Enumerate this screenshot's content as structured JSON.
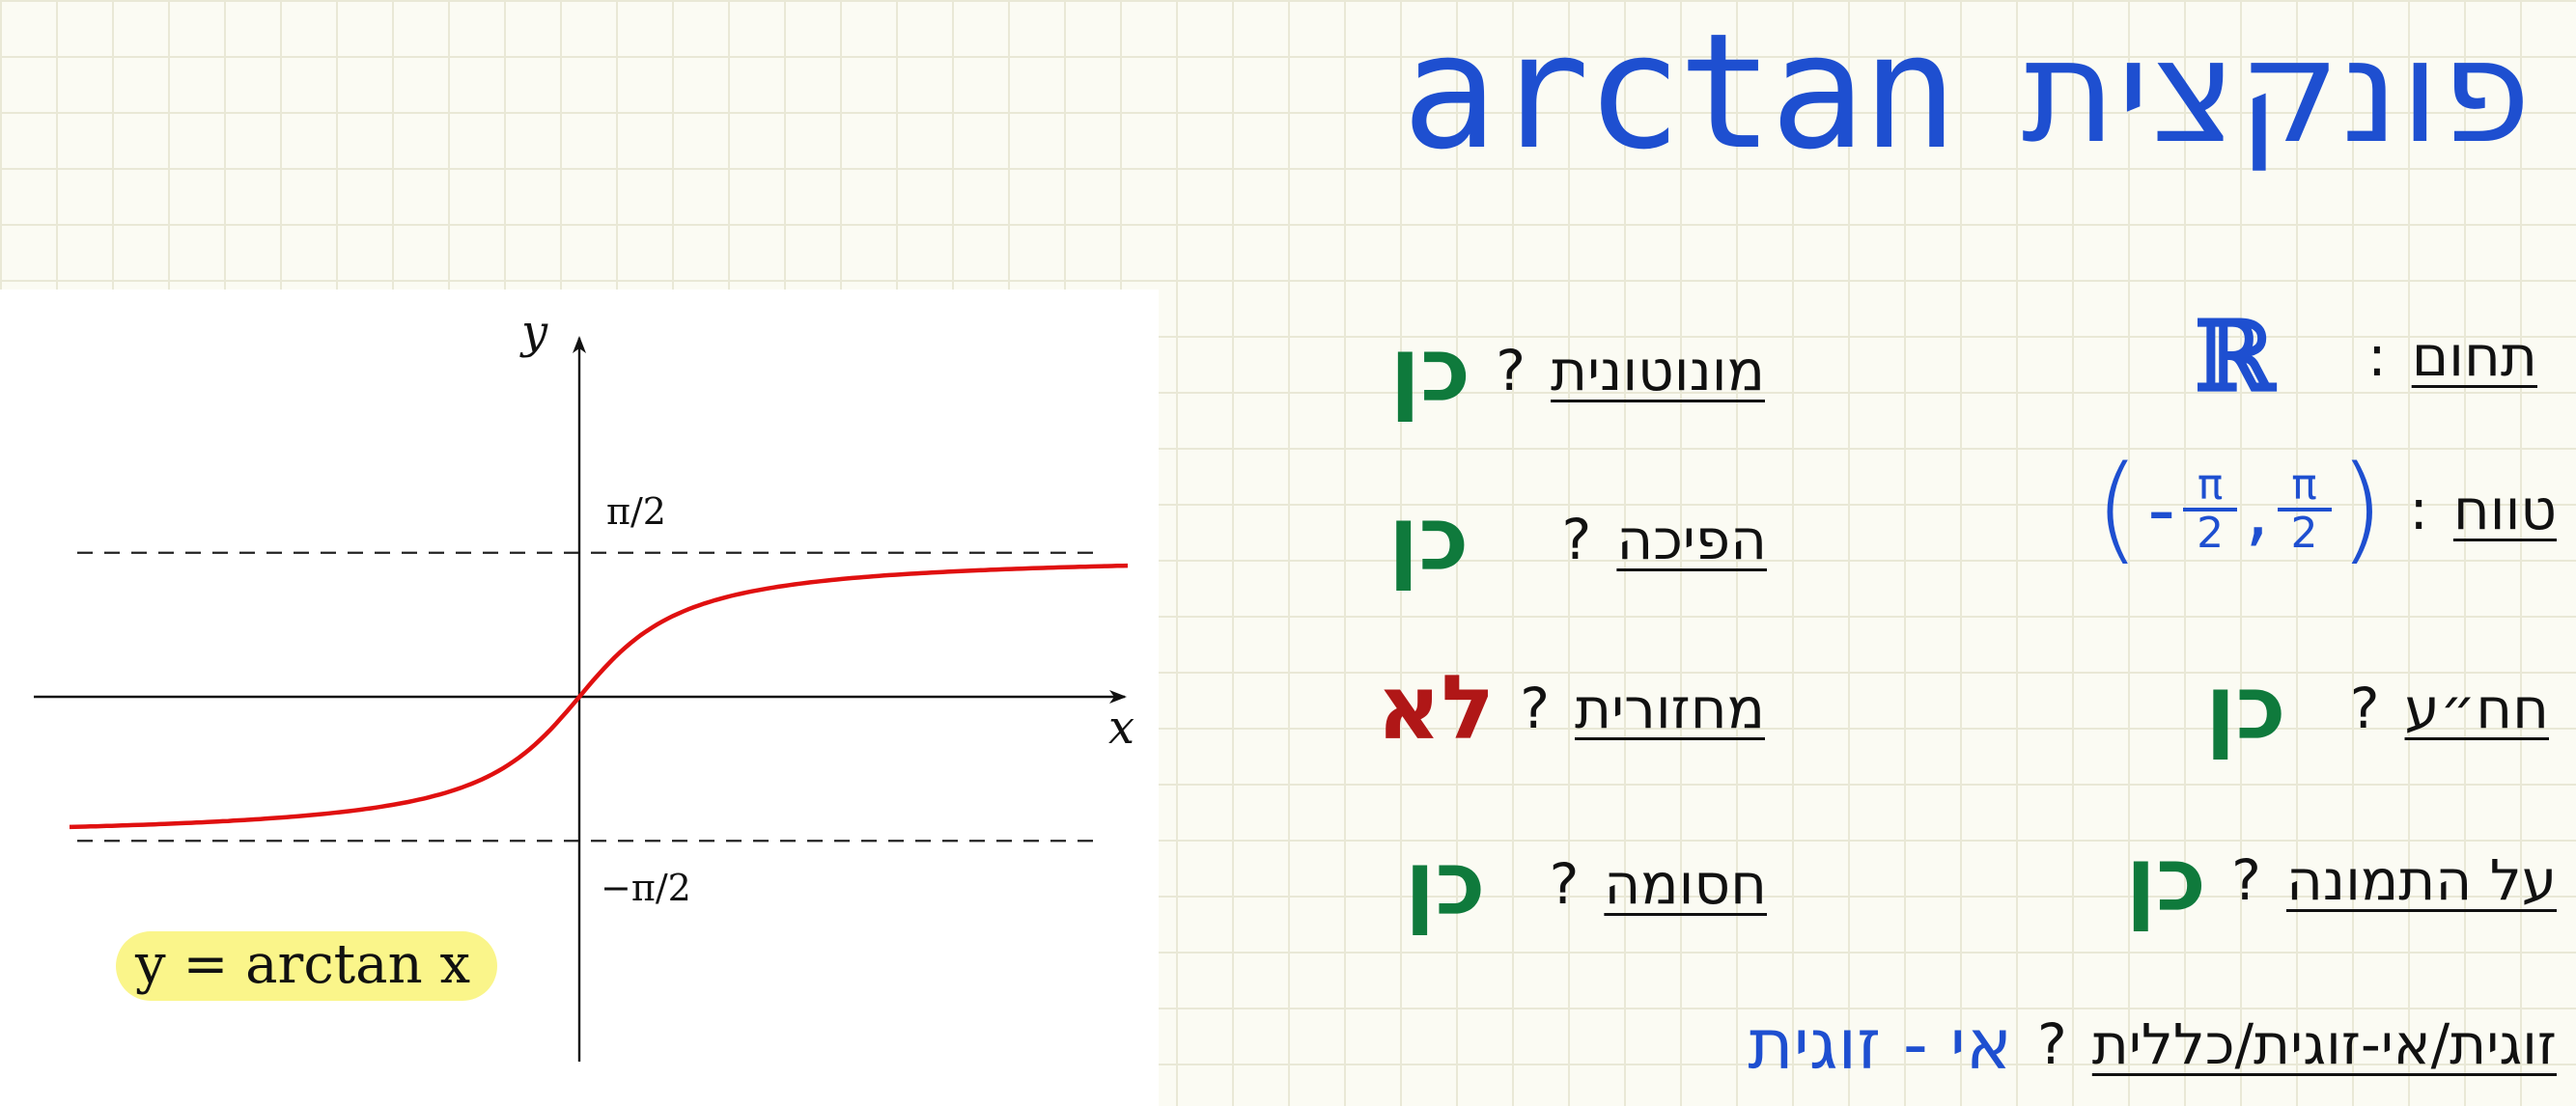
{
  "title": {
    "hebrew": "פונקצית",
    "name": "arctan"
  },
  "chart_data": {
    "type": "line",
    "function": "y = arctan x",
    "label": "y = arctan x",
    "xlabel": "x",
    "ylabel": "y",
    "xlim": [
      -7.5,
      7.5
    ],
    "ylim": [
      -4.9,
      4.9
    ],
    "asymptotes": [
      {
        "y": 1.5708,
        "label": "π/2",
        "style": "dashed"
      },
      {
        "y": -1.5708,
        "label": "−π/2",
        "style": "dashed"
      }
    ],
    "series": [
      {
        "color": "#e01010",
        "x": [
          -6.6,
          -6,
          -5,
          -4,
          -3,
          -2,
          -1.5,
          -1,
          -0.5,
          0,
          0.5,
          1,
          1.5,
          2,
          3,
          4,
          5,
          6,
          7.1
        ],
        "y": [
          -1.42,
          -1.406,
          -1.373,
          -1.326,
          -1.249,
          -1.107,
          -0.983,
          -0.785,
          -0.464,
          0,
          0.464,
          0.785,
          0.983,
          1.107,
          1.249,
          1.326,
          1.373,
          1.406,
          1.431
        ]
      }
    ],
    "legend": "bottom-left",
    "grid": false
  },
  "properties": {
    "domain": {
      "label": "תחום",
      "punct": ":",
      "value": "ℝ"
    },
    "range": {
      "label": "טווח",
      "punct": ":",
      "open": "(",
      "close": ")",
      "neg": "-",
      "num": "π",
      "den": "2",
      "comma": ","
    },
    "one_to_one": {
      "label": "חח״ע",
      "punct": "?",
      "answer": "כן"
    },
    "onto": {
      "label": "על התמונה",
      "punct": "?",
      "answer": "כן"
    },
    "monotonic": {
      "label": "מונוטונית",
      "punct": "?",
      "answer": "כן"
    },
    "invertible": {
      "label": "הפיכה",
      "punct": "?",
      "answer": "כן"
    },
    "periodic": {
      "label": "מחזורית",
      "punct": "?",
      "answer": "לא"
    },
    "bounded": {
      "label": "חסומה",
      "punct": "?",
      "answer": "כן"
    },
    "parity": {
      "label": "זוגית/אי-זוגית/כללית",
      "punct": "?",
      "answer": "אי - זוגית"
    }
  },
  "colors": {
    "title": "#1e4fd0",
    "yes": "#0f7a3c",
    "no": "#b01717",
    "curve": "#e01010",
    "label_highlight": "#faf58a"
  }
}
